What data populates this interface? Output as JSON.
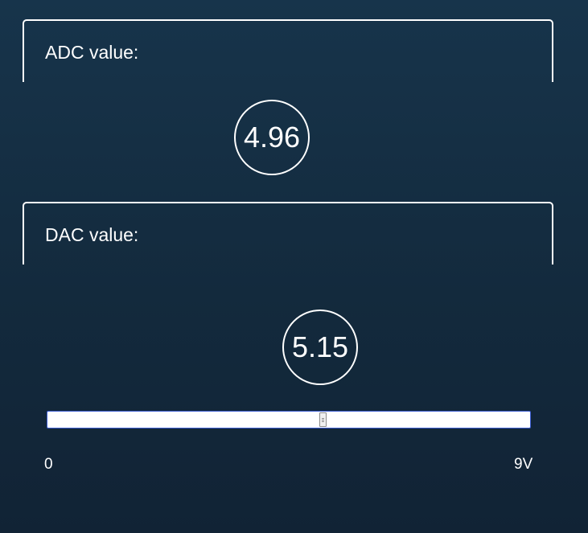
{
  "adc": {
    "label": "ADC value:",
    "value": "4.96"
  },
  "dac": {
    "label": "DAC value:",
    "value": "5.15",
    "slider": {
      "min_label": "0",
      "max_label": "9V",
      "min": 0,
      "max": 9,
      "value": 5.15
    }
  }
}
